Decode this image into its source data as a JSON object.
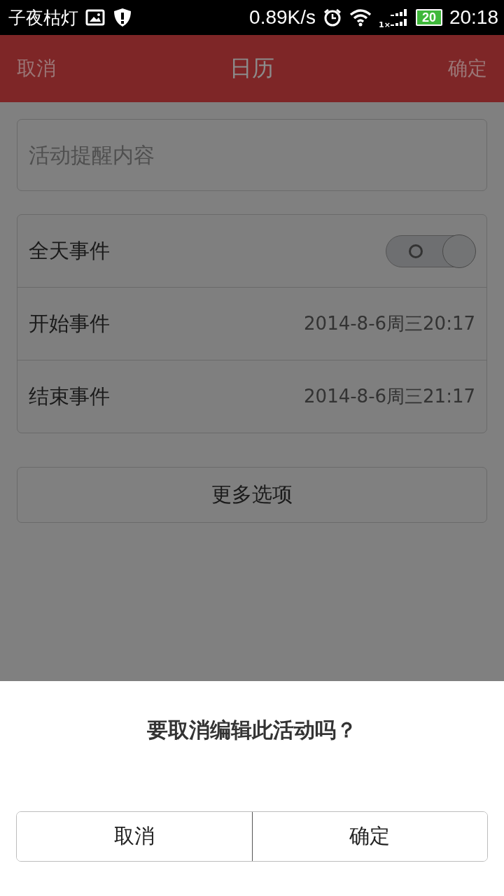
{
  "status_bar": {
    "carrier": "子夜枯灯",
    "speed": "0.89K/s",
    "network": "1×",
    "battery": "20",
    "time": "20:18"
  },
  "header": {
    "left": "取消",
    "title": "日历",
    "right": "确定"
  },
  "content_field": {
    "placeholder": "活动提醒内容"
  },
  "rows": [
    {
      "kind": "switch",
      "label": "全天事件",
      "on": false
    },
    {
      "kind": "value",
      "label": "开始事件",
      "value": "2014-8-6周三20:17"
    },
    {
      "kind": "value",
      "label": "结束事件",
      "value": "2014-8-6周三21:17"
    }
  ],
  "more_button": "更多选项",
  "dialog": {
    "message": "要取消编辑此活动吗？",
    "buttons": [
      "取消",
      "确定"
    ]
  }
}
